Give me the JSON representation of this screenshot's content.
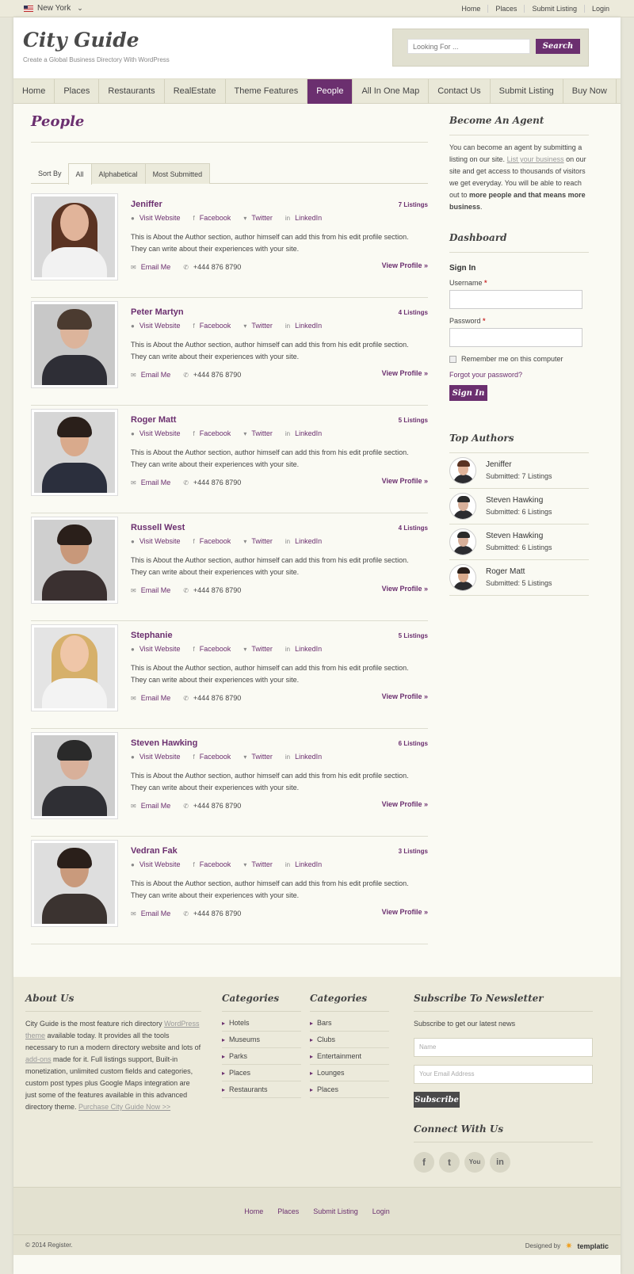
{
  "topbar": {
    "city": "New York",
    "links": [
      "Home",
      "Places",
      "Submit Listing",
      "Login"
    ]
  },
  "header": {
    "title": "City Guide",
    "tagline": "Create a Global Business Directory With WordPress",
    "search_placeholder": "Looking For ...",
    "search_button": "Search"
  },
  "nav": [
    "Home",
    "Places",
    "Restaurants",
    "RealEstate",
    "Theme Features",
    "People",
    "All In One Map",
    "Contact Us",
    "Submit Listing",
    "Buy Now"
  ],
  "page_title": "People",
  "sort": {
    "label": "Sort By",
    "tabs": [
      "All",
      "Alphabetical",
      "Most Submitted"
    ]
  },
  "social_labels": {
    "web": "Visit Website",
    "fb": "Facebook",
    "tw": "Twitter",
    "li": "LinkedIn",
    "email": "Email Me",
    "phone": "+444 876 8790",
    "view": "View Profile »"
  },
  "desc": "This is About the Author section, author himself can add this from his edit profile section. They can write about their experiences with your site.",
  "people": [
    {
      "name": "Jeniffer",
      "listings": "7 Listings"
    },
    {
      "name": "Peter Martyn",
      "listings": "4 Listings"
    },
    {
      "name": "Roger Matt",
      "listings": "5 Listings"
    },
    {
      "name": "Russell West",
      "listings": "4 Listings"
    },
    {
      "name": "Stephanie",
      "listings": "5 Listings"
    },
    {
      "name": "Steven Hawking",
      "listings": "6 Listings"
    },
    {
      "name": "Vedran Fak",
      "listings": "3 Listings"
    }
  ],
  "sidebar": {
    "agent_title": "Become An Agent",
    "agent_text_1": "You can become an agent by submitting a listing on our site.",
    "agent_link": "List your business",
    "agent_text_2": "on our site and get access to thousands of visitors we get everyday. You will be able to reach out to",
    "agent_bold": "more people and that means more business",
    "agent_end": ".",
    "dash_title": "Dashboard",
    "signin": "Sign In",
    "username": "Username",
    "password": "Password",
    "remember": "Remember me on this computer",
    "forgot": "Forgot your password?",
    "signin_btn": "Sign In",
    "authors_title": "Top Authors",
    "authors": [
      {
        "name": "Jeniffer",
        "sub": "Submitted: 7 Listings"
      },
      {
        "name": "Steven Hawking",
        "sub": "Submitted: 6 Listings"
      },
      {
        "name": "Steven Hawking",
        "sub": "Submitted: 6 Listings"
      },
      {
        "name": "Roger Matt",
        "sub": "Submitted: 5 Listings"
      }
    ]
  },
  "footer": {
    "about_title": "About Us",
    "about_1": "City Guide is the most feature rich directory",
    "about_link1": "WordPress theme",
    "about_2": "available today. It provides all the tools necessary to run a modern directory website and lots of",
    "about_link2": "add-ons",
    "about_3": "made for it. Full listings support, Built-in monetization, unlimited custom fields and categories, custom post types plus Google Maps integration are just some of the features available in this advanced directory theme.",
    "about_link3": "Purchase City Guide Now >>",
    "cat1_title": "Categories",
    "cat1": [
      "Hotels",
      "Museums",
      "Parks",
      "Places",
      "Restaurants"
    ],
    "cat2_title": "Categories",
    "cat2": [
      "Bars",
      "Clubs",
      "Entertainment",
      "Lounges",
      "Places"
    ],
    "news_title": "Subscribe To Newsletter",
    "news_text": "Subscribe to get our latest news",
    "name_placeholder": "Name",
    "email_placeholder": "Your Email Address",
    "subscribe": "Subscribe",
    "connect_title": "Connect With Us",
    "social": [
      "f",
      "t",
      "You",
      "in"
    ],
    "nav": [
      "Home",
      "Places",
      "Submit Listing",
      "Login"
    ],
    "copyright": "© 2014 Register.",
    "designed_by": "Designed by",
    "brand": "templatic"
  }
}
